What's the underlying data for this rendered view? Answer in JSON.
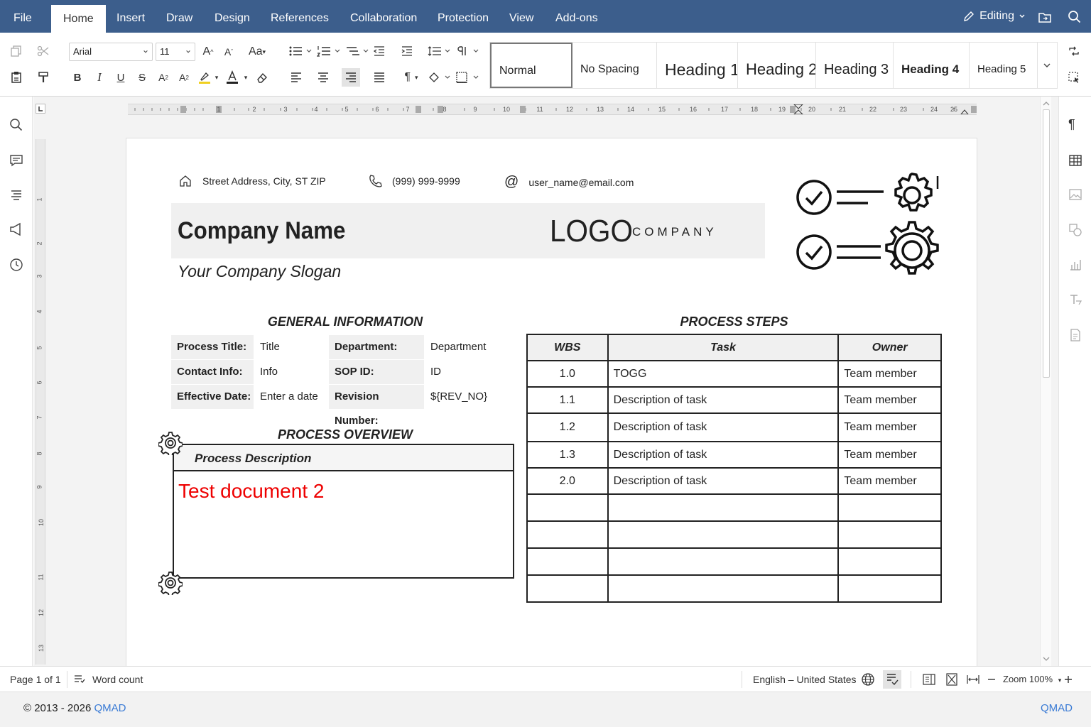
{
  "menu": {
    "tabs": [
      "File",
      "Home",
      "Insert",
      "Draw",
      "Design",
      "References",
      "Collaboration",
      "Protection",
      "View",
      "Add-ons"
    ],
    "active_tab": "Home",
    "mode": "Editing"
  },
  "ribbon": {
    "font_name": "Arial",
    "font_size": "11",
    "styles": [
      "Normal",
      "No Spacing",
      "Heading 1",
      "Heading 2",
      "Heading 3",
      "Heading 4",
      "Heading 5"
    ],
    "selected_style": "Normal"
  },
  "ruler": {
    "h_numbers": [
      "1",
      "1",
      "2",
      "3",
      "4",
      "5",
      "6",
      "7",
      "8",
      "9",
      "10",
      "11",
      "12",
      "13",
      "14",
      "15",
      "16",
      "17",
      "18",
      "19",
      "20",
      "21",
      "22",
      "23",
      "24",
      "25"
    ],
    "v_numbers": [
      "1",
      "2",
      "3",
      "4",
      "5",
      "6",
      "7",
      "8",
      "9",
      "10",
      "11",
      "12",
      "13"
    ]
  },
  "document": {
    "address": "Street Address, City, ST  ZIP",
    "phone": "(999) 999-9999",
    "email": "user_name@email.com",
    "company_name": "Company Name",
    "logo_text": "LOGO",
    "logo_sub": "COMPANY",
    "slogan": "Your Company Slogan",
    "general_info_title": "GENERAL INFORMATION",
    "general_info": [
      {
        "label": "Process Title:",
        "value": "Title",
        "label2": "Department:",
        "value2": "Department"
      },
      {
        "label": "Contact Info:",
        "value": "Info",
        "label2": "SOP ID:",
        "value2": "ID"
      },
      {
        "label": "Effective Date:",
        "value": "Enter a date",
        "label2": "Revision Number:",
        "value2": "${REV_NO}"
      }
    ],
    "overview_title": "PROCESS OVERVIEW",
    "overview_header": "Process Description",
    "overview_text": "Test document 2",
    "steps_title": "PROCESS STEPS",
    "steps_columns": [
      "WBS",
      "Task",
      "Owner"
    ],
    "steps_rows": [
      [
        "1.0",
        "TOGG",
        "Team member"
      ],
      [
        "1.1",
        "Description of task",
        "Team member"
      ],
      [
        "1.2",
        "Description of task",
        "Team member"
      ],
      [
        "1.3",
        "Description of task",
        "Team member"
      ],
      [
        "2.0",
        "Description of task",
        "Team member"
      ],
      [
        "",
        "",
        ""
      ],
      [
        "",
        "",
        ""
      ],
      [
        "",
        "",
        ""
      ],
      [
        "",
        "",
        ""
      ]
    ]
  },
  "status": {
    "page": "Page 1 of 1",
    "word_count": "Word count",
    "language": "English – United States",
    "zoom": "Zoom 100%"
  },
  "footer": {
    "copyright": "© 2013 - 2026",
    "brand": "QMAD",
    "brand_right": "QMAD"
  },
  "colors": {
    "menubar": "#3c5e8c",
    "overview_text": "#e00000",
    "link": "#3a7bd5"
  }
}
